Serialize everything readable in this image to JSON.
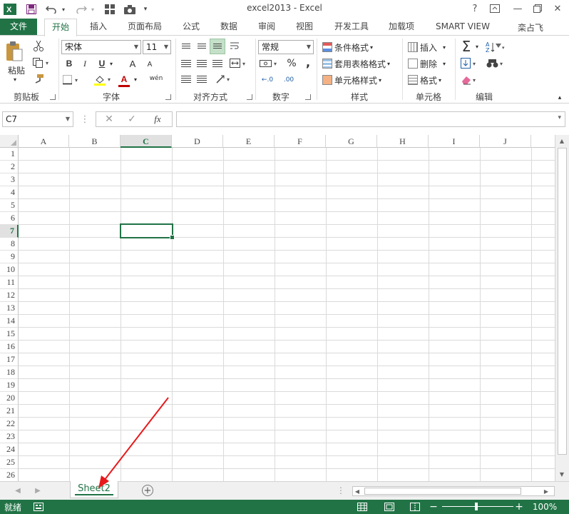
{
  "window": {
    "title": "excel2013 - Excel",
    "help": "?",
    "minimize": "—",
    "close": "✕"
  },
  "ribbon_tabs": [
    "文件",
    "开始",
    "插入",
    "页面布局",
    "公式",
    "数据",
    "审阅",
    "视图",
    "开发工具",
    "加载项",
    "SMART VIEW"
  ],
  "user": {
    "name": "栾占飞"
  },
  "clipboard": {
    "paste": "粘贴",
    "group": "剪贴板"
  },
  "font": {
    "name": "宋体",
    "size": "11",
    "bold": "B",
    "italic": "I",
    "underline": "U",
    "grow": "A",
    "shrink": "A",
    "font_color": "A",
    "phonetic": "wén",
    "group": "字体"
  },
  "alignment": {
    "group": "对齐方式"
  },
  "number": {
    "format": "常规",
    "percent": "%",
    "comma": ",",
    "inc": "←.0",
    "dec": ".00",
    "group": "数字"
  },
  "styles": {
    "conditional": "条件格式",
    "table": "套用表格格式",
    "cell": "单元格样式",
    "group": "样式"
  },
  "cells_group": {
    "insert": "插入",
    "delete": "删除",
    "format": "格式",
    "group": "单元格"
  },
  "editing": {
    "sum": "Σ",
    "sort": "A Z",
    "group": "编辑"
  },
  "formula_bar": {
    "name_box": "C7",
    "fx": "fx",
    "content": ""
  },
  "grid": {
    "columns": [
      "A",
      "B",
      "C",
      "D",
      "E",
      "F",
      "G",
      "H",
      "I",
      "J"
    ],
    "rows": [
      "1",
      "2",
      "3",
      "4",
      "5",
      "6",
      "7",
      "8",
      "9",
      "10",
      "11",
      "12",
      "13",
      "14",
      "15",
      "16",
      "17",
      "18",
      "19",
      "20",
      "21",
      "22",
      "23",
      "24",
      "25",
      "26"
    ],
    "selected_column": "C",
    "selected_row": "7"
  },
  "sheets": {
    "tabs": [
      "Sheet2"
    ],
    "active": "Sheet2",
    "add": "+"
  },
  "status": {
    "ready": "就绪",
    "zoom": "100%"
  },
  "colors": {
    "excel_green": "#217346",
    "annotation_red": "#e8191b"
  }
}
